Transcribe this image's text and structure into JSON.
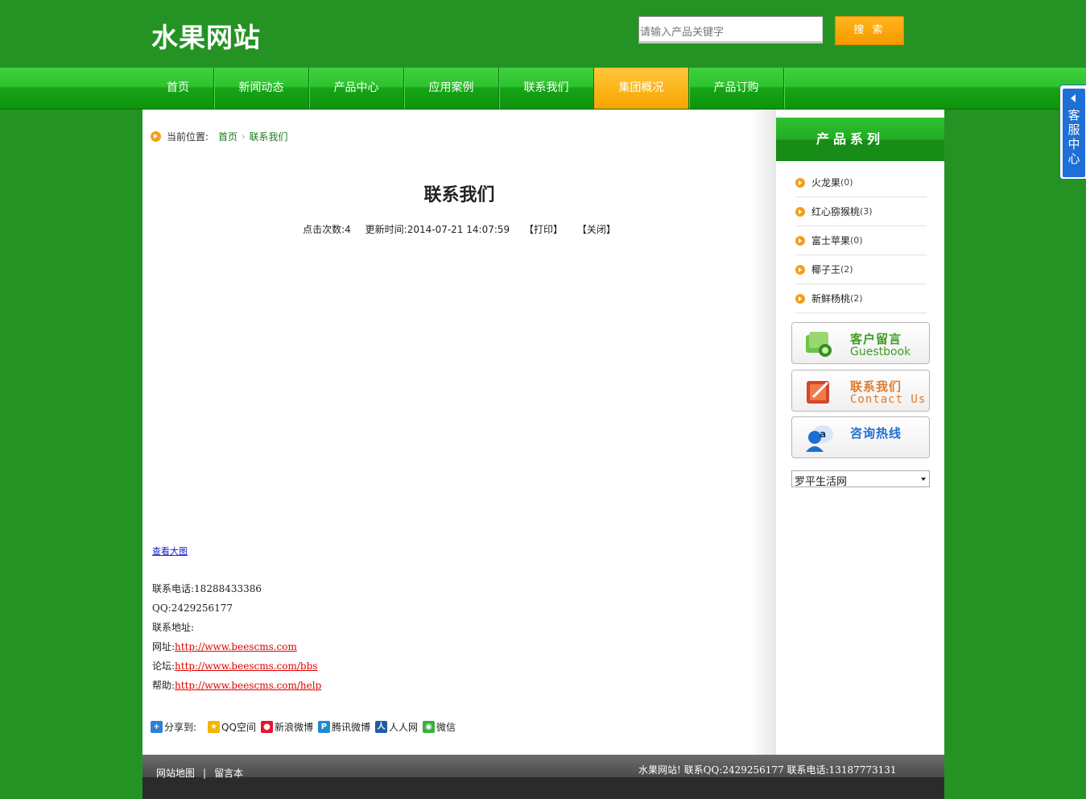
{
  "header": {
    "logo": "水果网站",
    "search_placeholder": "请输入产品关键字",
    "search_button": "搜 索"
  },
  "nav": {
    "items": [
      {
        "label": "首页"
      },
      {
        "label": "新闻动态"
      },
      {
        "label": "产品中心"
      },
      {
        "label": "应用案例"
      },
      {
        "label": "联系我们"
      },
      {
        "label": "集团概况",
        "active": true
      },
      {
        "label": "产品订购"
      }
    ]
  },
  "breadcrumb": {
    "label": "当前位置:",
    "home": "首页",
    "separator": "›",
    "current": "联系我们"
  },
  "article": {
    "title": "联系我们",
    "views": "点击次数:4",
    "updated": "更新时间:2014-07-21 14:07:59",
    "print": "【打印】",
    "close": "【关闭】",
    "view_large": "查看大图",
    "phone": "联系电话:18288433386",
    "qq": "QQ:2429256177",
    "address": "联系地址:",
    "site_label": "网址:",
    "site_url": "http://www.beescms.com",
    "forum_label": "论坛:",
    "forum_url": "http://www.beescms.com/bbs",
    "help_label": "帮助:",
    "help_url": "http://www.beescms.com/help"
  },
  "share": {
    "label": "分享到:",
    "items": [
      {
        "label": "QQ空间",
        "color": "#f5b400",
        "icon": "qzone-icon"
      },
      {
        "label": "新浪微博",
        "color": "#e6162d",
        "icon": "weibo-icon"
      },
      {
        "label": "腾讯微博",
        "color": "#1f8ad6",
        "icon": "tencent-weibo-icon"
      },
      {
        "label": "人人网",
        "color": "#1d5ca8",
        "icon": "renren-icon"
      },
      {
        "label": "微信",
        "color": "#3bb03b",
        "icon": "wechat-icon"
      }
    ]
  },
  "sidebar": {
    "title": "产品系列",
    "categories": [
      {
        "name": "火龙果",
        "count": "(0)"
      },
      {
        "name": "红心猕猴桃",
        "count": "(3)"
      },
      {
        "name": "富士苹果",
        "count": "(0)"
      },
      {
        "name": "椰子王",
        "count": "(2)"
      },
      {
        "name": "新鲜杨桃",
        "count": " (2)"
      }
    ],
    "promos": [
      {
        "cn": "客户留言",
        "en": "Guestbook",
        "color": "#3b9e1e",
        "icon": "guestbook-icon"
      },
      {
        "cn": "联系我们",
        "en": "Contact Us",
        "color": "#e07a2a",
        "icon": "contact-book-icon"
      },
      {
        "cn": "咨询热线",
        "en": "",
        "color": "#1c6fd0",
        "icon": "hotline-icon"
      }
    ],
    "links_select": "罗平生活网"
  },
  "footer": {
    "sitemap": "网站地图",
    "separator": "|",
    "guestbook": "留言本",
    "info": "水果网站! 联系QQ:2429256177 联系电话:13187773131"
  },
  "service_tab": {
    "text": "客服中心"
  },
  "colors": {
    "page_bg": "#249324",
    "accent_orange": "#f59a00",
    "link_red": "#e00000"
  }
}
